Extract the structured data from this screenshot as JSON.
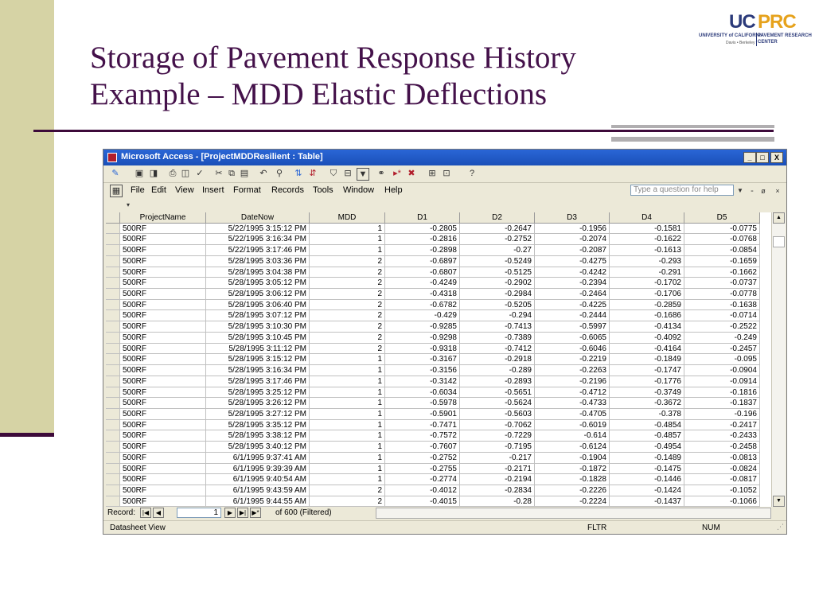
{
  "slide": {
    "title_line1": "Storage of Pavement Response History",
    "title_line2": "Example – MDD Elastic Deflections"
  },
  "logo": {
    "uc": "UC",
    "prc": "PRC",
    "left_line": "UNIVERSITY of CALIFORNIA",
    "right_line1": "PAVEMENT RESEARCH",
    "right_line2": "CENTER",
    "campuses": "Davis • Berkeley"
  },
  "window": {
    "title": "Microsoft Access - [ProjectMDDResilient : Table]",
    "min_label": "_",
    "max_label": "□",
    "close_label": "X"
  },
  "menu": {
    "items": [
      "File",
      "Edit",
      "View",
      "Insert",
      "Format",
      "Records",
      "Tools",
      "Window",
      "Help"
    ],
    "ask_placeholder": "Type a question for help"
  },
  "grid": {
    "columns": [
      "ProjectName",
      "DateNow",
      "MDD",
      "D1",
      "D2",
      "D3",
      "D4",
      "D5"
    ],
    "rows": [
      [
        "500RF",
        "5/22/1995 3:15:12 PM",
        "1",
        "-0.2805",
        "-0.2647",
        "-0.1956",
        "-0.1581",
        "-0.0775"
      ],
      [
        "500RF",
        "5/22/1995 3:16:34 PM",
        "1",
        "-0.2816",
        "-0.2752",
        "-0.2074",
        "-0.1622",
        "-0.0768"
      ],
      [
        "500RF",
        "5/22/1995 3:17:46 PM",
        "1",
        "-0.2898",
        "-0.27",
        "-0.2087",
        "-0.1613",
        "-0.0854"
      ],
      [
        "500RF",
        "5/28/1995 3:03:36 PM",
        "2",
        "-0.6897",
        "-0.5249",
        "-0.4275",
        "-0.293",
        "-0.1659"
      ],
      [
        "500RF",
        "5/28/1995 3:04:38 PM",
        "2",
        "-0.6807",
        "-0.5125",
        "-0.4242",
        "-0.291",
        "-0.1662"
      ],
      [
        "500RF",
        "5/28/1995 3:05:12 PM",
        "2",
        "-0.4249",
        "-0.2902",
        "-0.2394",
        "-0.1702",
        "-0.0737"
      ],
      [
        "500RF",
        "5/28/1995 3:06:12 PM",
        "2",
        "-0.4318",
        "-0.2984",
        "-0.2464",
        "-0.1706",
        "-0.0778"
      ],
      [
        "500RF",
        "5/28/1995 3:06:40 PM",
        "2",
        "-0.6782",
        "-0.5205",
        "-0.4225",
        "-0.2859",
        "-0.1638"
      ],
      [
        "500RF",
        "5/28/1995 3:07:12 PM",
        "2",
        "-0.429",
        "-0.294",
        "-0.2444",
        "-0.1686",
        "-0.0714"
      ],
      [
        "500RF",
        "5/28/1995 3:10:30 PM",
        "2",
        "-0.9285",
        "-0.7413",
        "-0.5997",
        "-0.4134",
        "-0.2522"
      ],
      [
        "500RF",
        "5/28/1995 3:10:45 PM",
        "2",
        "-0.9298",
        "-0.7389",
        "-0.6065",
        "-0.4092",
        "-0.249"
      ],
      [
        "500RF",
        "5/28/1995 3:11:12 PM",
        "2",
        "-0.9318",
        "-0.7412",
        "-0.6046",
        "-0.4164",
        "-0.2457"
      ],
      [
        "500RF",
        "5/28/1995 3:15:12 PM",
        "1",
        "-0.3167",
        "-0.2918",
        "-0.2219",
        "-0.1849",
        "-0.095"
      ],
      [
        "500RF",
        "5/28/1995 3:16:34 PM",
        "1",
        "-0.3156",
        "-0.289",
        "-0.2263",
        "-0.1747",
        "-0.0904"
      ],
      [
        "500RF",
        "5/28/1995 3:17:46 PM",
        "1",
        "-0.3142",
        "-0.2893",
        "-0.2196",
        "-0.1776",
        "-0.0914"
      ],
      [
        "500RF",
        "5/28/1995 3:25:12 PM",
        "1",
        "-0.6034",
        "-0.5651",
        "-0.4712",
        "-0.3749",
        "-0.1816"
      ],
      [
        "500RF",
        "5/28/1995 3:26:12 PM",
        "1",
        "-0.5978",
        "-0.5624",
        "-0.4733",
        "-0.3672",
        "-0.1837"
      ],
      [
        "500RF",
        "5/28/1995 3:27:12 PM",
        "1",
        "-0.5901",
        "-0.5603",
        "-0.4705",
        "-0.378",
        "-0.196"
      ],
      [
        "500RF",
        "5/28/1995 3:35:12 PM",
        "1",
        "-0.7471",
        "-0.7062",
        "-0.6019",
        "-0.4854",
        "-0.2417"
      ],
      [
        "500RF",
        "5/28/1995 3:38:12 PM",
        "1",
        "-0.7572",
        "-0.7229",
        "-0.614",
        "-0.4857",
        "-0.2433"
      ],
      [
        "500RF",
        "5/28/1995 3:40:12 PM",
        "1",
        "-0.7607",
        "-0.7195",
        "-0.6124",
        "-0.4954",
        "-0.2458"
      ],
      [
        "500RF",
        "6/1/1995 9:37:41 AM",
        "1",
        "-0.2752",
        "-0.217",
        "-0.1904",
        "-0.1489",
        "-0.0813"
      ],
      [
        "500RF",
        "6/1/1995 9:39:39 AM",
        "1",
        "-0.2755",
        "-0.2171",
        "-0.1872",
        "-0.1475",
        "-0.0824"
      ],
      [
        "500RF",
        "6/1/1995 9:40:54 AM",
        "1",
        "-0.2774",
        "-0.2194",
        "-0.1828",
        "-0.1446",
        "-0.0817"
      ],
      [
        "500RF",
        "6/1/1995 9:43:59 AM",
        "2",
        "-0.4012",
        "-0.2834",
        "-0.2226",
        "-0.1424",
        "-0.1052"
      ],
      [
        "500RF",
        "6/1/1995 9:44:55 AM",
        "2",
        "-0.4015",
        "-0.28",
        "-0.2224",
        "-0.1437",
        "-0.1066"
      ]
    ]
  },
  "nav": {
    "record_label": "Record:",
    "current": "1",
    "of_text": "of  600 (Filtered)"
  },
  "status": {
    "view": "Datasheet View",
    "fltr": "FLTR",
    "num": "NUM"
  },
  "colors": {
    "title": "#44114a",
    "band": "#d6d3a5",
    "rule": "#3d0a3a",
    "titlebar": "#2a66d6"
  }
}
